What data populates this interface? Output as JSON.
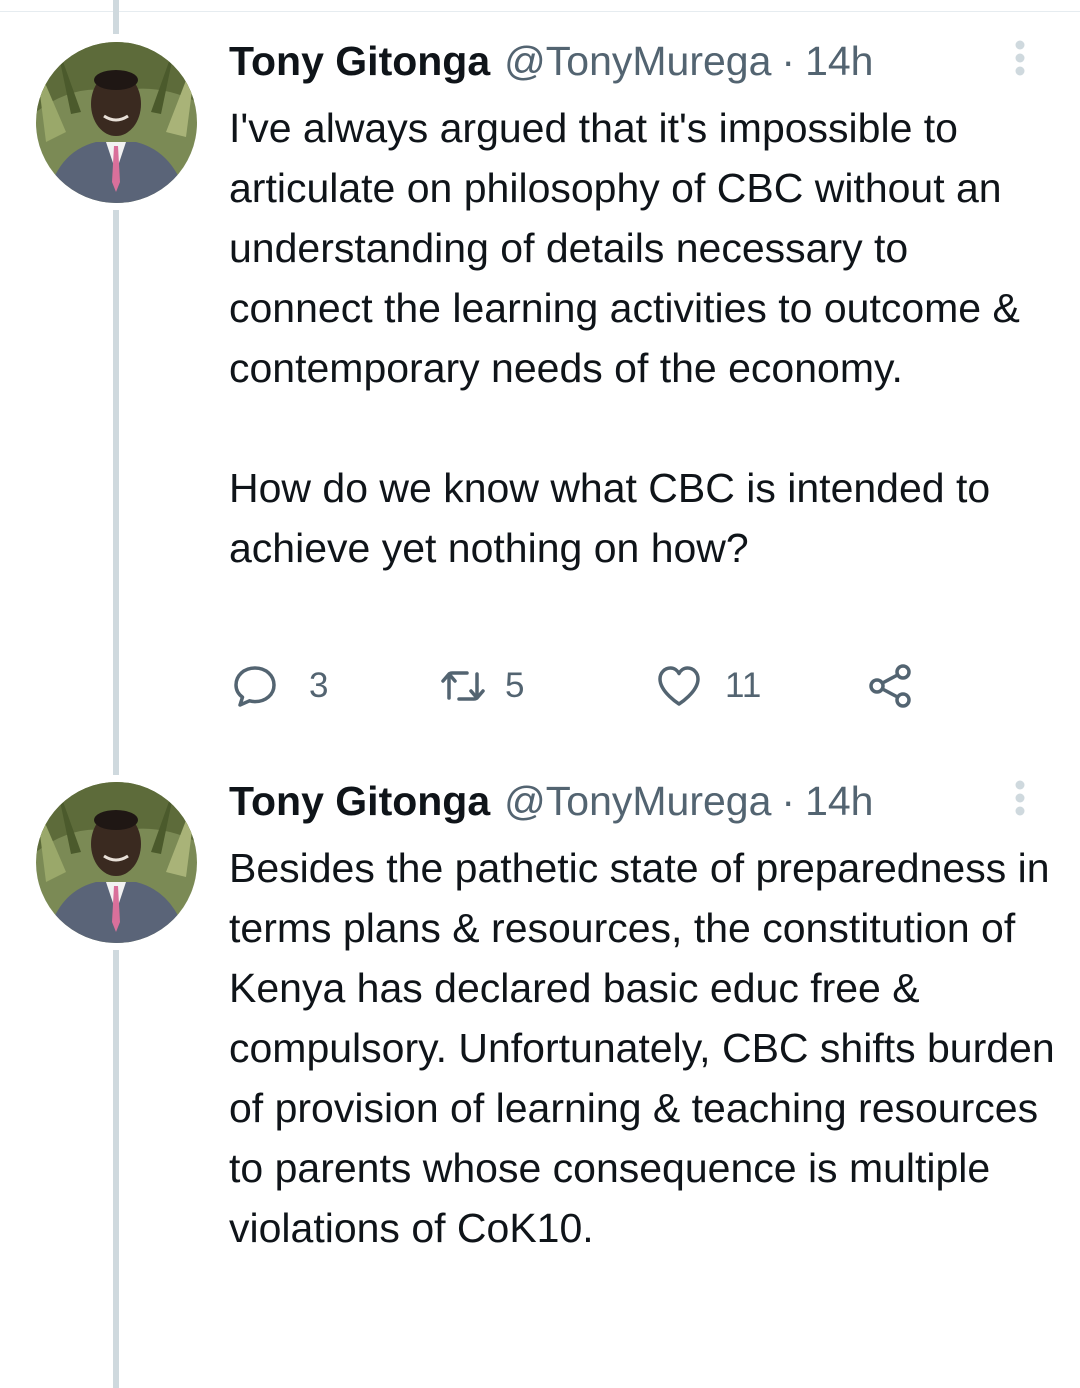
{
  "tweets": [
    {
      "author": {
        "name": "Tony Gitonga",
        "handle": "@TonyMurega",
        "separator": "·",
        "time": "14h",
        "avatar_icon": "profile-photo"
      },
      "paragraphs": [
        "I've always argued that it's impossible to articulate on philosophy of CBC without an understanding of details necessary to connect the learning activities to outcome & contemporary needs of the economy.",
        "How do we know what CBC is intended to achieve yet nothing on how?"
      ],
      "actions": {
        "replies": "3",
        "retweets": "5",
        "likes": "11"
      }
    },
    {
      "author": {
        "name": "Tony Gitonga",
        "handle": "@TonyMurega",
        "separator": "·",
        "time": "14h",
        "avatar_icon": "profile-photo"
      },
      "paragraphs": [
        "Besides the pathetic state of preparedness in terms plans & resources, the constitution of Kenya has declared basic educ free & compulsory. Unfortunately, CBC shifts burden of provision of learning & teaching resources to parents whose consequence is multiple violations of CoK10."
      ]
    }
  ],
  "colors": {
    "text_primary": "#0f1419",
    "text_secondary": "#536471",
    "thread_line": "#cfd9de"
  }
}
